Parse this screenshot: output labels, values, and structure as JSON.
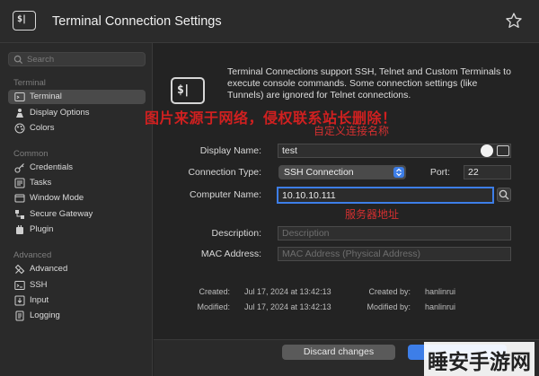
{
  "window": {
    "title": "Terminal Connection Settings"
  },
  "sidebar": {
    "search_placeholder": "Search",
    "sections": [
      {
        "label": "Terminal",
        "items": [
          {
            "label": "Terminal",
            "icon": "terminal-icon",
            "selected": true
          },
          {
            "label": "Display Options",
            "icon": "display-options-icon",
            "selected": false
          },
          {
            "label": "Colors",
            "icon": "colors-icon",
            "selected": false
          }
        ]
      },
      {
        "label": "Common",
        "items": [
          {
            "label": "Credentials",
            "icon": "key-icon",
            "selected": false
          },
          {
            "label": "Tasks",
            "icon": "tasks-icon",
            "selected": false
          },
          {
            "label": "Window Mode",
            "icon": "window-icon",
            "selected": false
          },
          {
            "label": "Secure Gateway",
            "icon": "gateway-icon",
            "selected": false
          },
          {
            "label": "Plugin",
            "icon": "plugin-icon",
            "selected": false
          }
        ]
      },
      {
        "label": "Advanced",
        "items": [
          {
            "label": "Advanced",
            "icon": "tools-icon",
            "selected": false
          },
          {
            "label": "SSH",
            "icon": "ssh-icon",
            "selected": false
          },
          {
            "label": "Input",
            "icon": "input-icon",
            "selected": false
          },
          {
            "label": "Logging",
            "icon": "logging-icon",
            "selected": false
          }
        ]
      }
    ]
  },
  "main": {
    "intro": "Terminal Connections support SSH, Telnet and Custom Terminals to execute console commands. Some connection settings (like Tunnels) are ignored for Telnet connections.",
    "watermark": "图片来源于网络，侵权联系站长删除！",
    "annotations": {
      "name": "自定义连接名称",
      "server": "服务器地址"
    },
    "form": {
      "display_name_label": "Display Name:",
      "display_name_value": "test",
      "connection_type_label": "Connection Type:",
      "connection_type_value": "SSH Connection",
      "port_label": "Port:",
      "port_value": "22",
      "computer_name_label": "Computer Name:",
      "computer_name_value": "10.10.10.111",
      "description_label": "Description:",
      "description_placeholder": "Description",
      "mac_label": "MAC Address:",
      "mac_placeholder": "MAC Address (Physical Address)"
    },
    "meta": {
      "created_label": "Created:",
      "created_value": "Jul 17, 2024 at 13:42:13",
      "created_by_label": "Created by:",
      "created_by_value": "hanlinrui",
      "modified_label": "Modified:",
      "modified_value": "Jul 17, 2024 at 13:42:13",
      "modified_by_label": "Modified by:",
      "modified_by_value": "hanlinrui"
    }
  },
  "footer": {
    "discard_label": "Discard changes",
    "save_label": ""
  },
  "logo": "睡安手游网",
  "colors": {
    "accent": "#3d7ee8",
    "annotation": "#d43030"
  }
}
